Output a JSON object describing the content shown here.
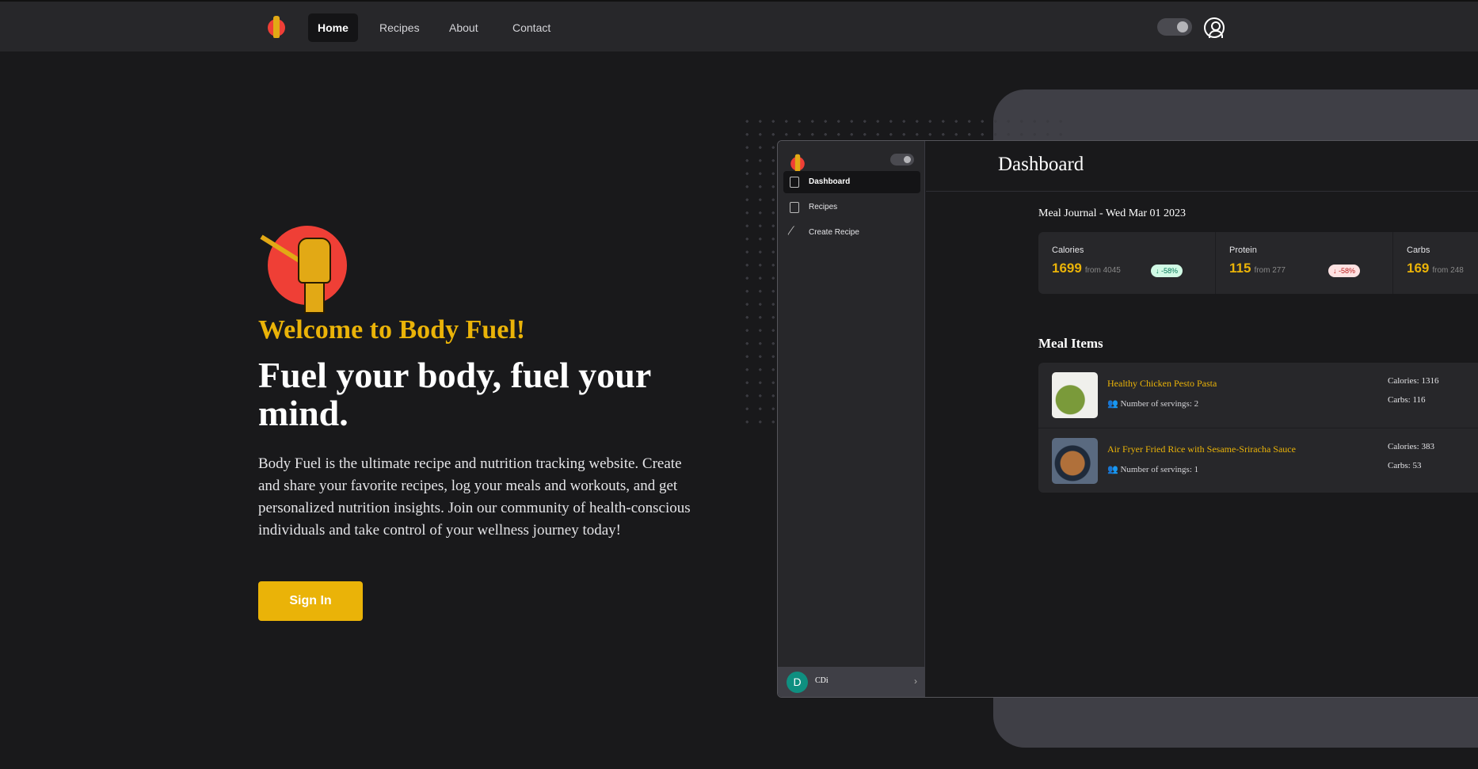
{
  "nav": {
    "links": [
      "Home",
      "Recipes",
      "About",
      "Contact"
    ]
  },
  "hero": {
    "welcome": "Welcome to Body Fuel!",
    "headline": "Fuel your body, fuel your mind.",
    "paragraph": "Body Fuel is the ultimate recipe and nutrition tracking website. Create and share your favorite recipes, log your meals and workouts, and get personalized nutrition insights. Join our community of health-conscious individuals and take control of your wellness journey today!",
    "signin": "Sign In"
  },
  "preview": {
    "sidebar": {
      "items": [
        "Dashboard",
        "Recipes",
        "Create Recipe"
      ],
      "user_initial": "D",
      "user_name": "CDi"
    },
    "title": "Dashboard",
    "journal": "Meal Journal - Wed Mar 01 2023",
    "stats": [
      {
        "label": "Calories",
        "value": "1699",
        "from": "from 4045",
        "change": "-58%"
      },
      {
        "label": "Protein",
        "value": "115",
        "from": "from 277",
        "change": "-58%"
      },
      {
        "label": "Carbs",
        "value": "169",
        "from": "from 248"
      }
    ],
    "meal_items_title": "Meal Items",
    "meals": [
      {
        "name": "Healthy Chicken Pesto Pasta",
        "servings": "Number of servings: 2",
        "calories": "Calories: 1316",
        "carbs": "Carbs: 116"
      },
      {
        "name": "Air Fryer Fried Rice with Sesame-Sriracha Sauce",
        "servings": "Number of servings: 1",
        "calories": "Calories: 383",
        "carbs": "Carbs: 53"
      }
    ]
  }
}
